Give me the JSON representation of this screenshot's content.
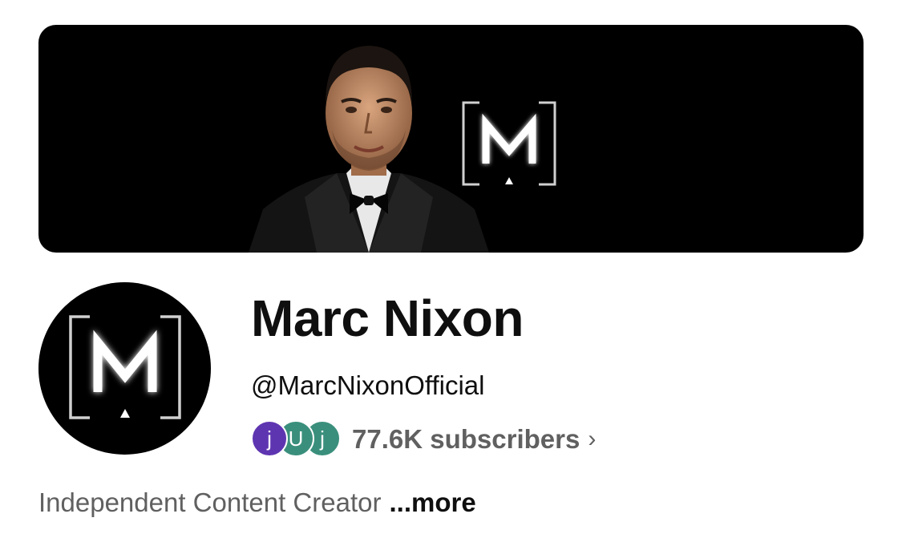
{
  "channel": {
    "name": "Marc Nixon",
    "handle": "@MarcNixonOfficial",
    "logo_letter": "M"
  },
  "subscribers": {
    "avatars": [
      {
        "letter": "j",
        "color": "#5e35b1"
      },
      {
        "letter": "U",
        "color": "#3a8f7c"
      },
      {
        "letter": "j",
        "color": "#3a8f7c"
      }
    ],
    "count_text": "77.6K subscribers",
    "chevron": "›"
  },
  "description": {
    "text": "Independent Content Creator",
    "more_label": "...more"
  },
  "colors": {
    "banner_bg": "#000000",
    "text_primary": "#0f0f0f",
    "text_secondary": "#606060"
  }
}
